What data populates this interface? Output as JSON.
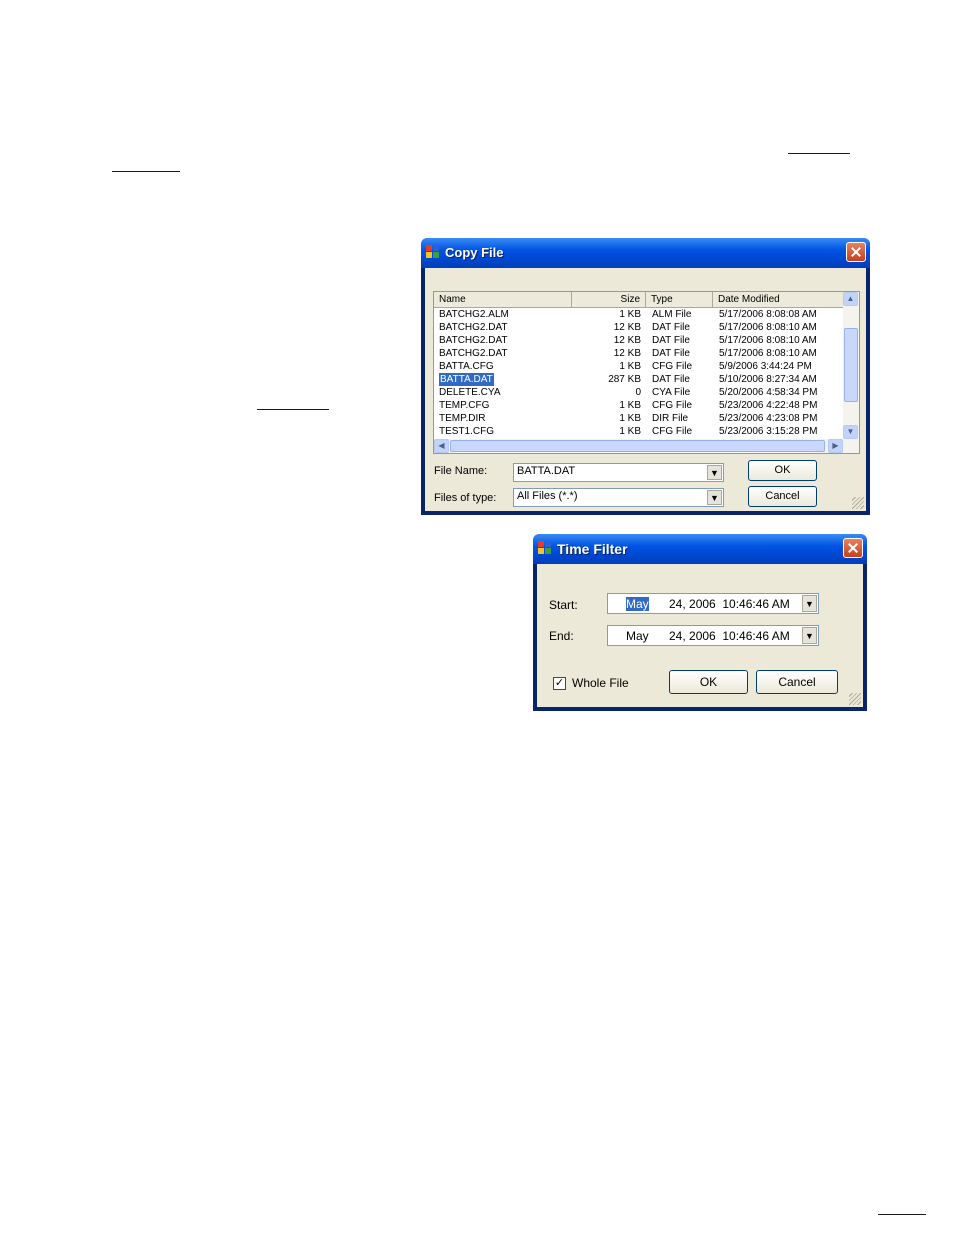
{
  "copy_file": {
    "title": "Copy File",
    "columns": [
      "Name",
      "Size",
      "Type",
      "Date Modified"
    ],
    "files": [
      {
        "name": "BATCHG2.ALM",
        "size": "1 KB",
        "type": "ALM File",
        "date": "5/17/2006 8:08:08 AM"
      },
      {
        "name": "BATCHG2.DAT",
        "size": "12 KB",
        "type": "DAT File",
        "date": "5/17/2006 8:08:10 AM"
      },
      {
        "name": "BATCHG2.DAT",
        "size": "12 KB",
        "type": "DAT File",
        "date": "5/17/2006 8:08:10 AM"
      },
      {
        "name": "BATCHG2.DAT",
        "size": "12 KB",
        "type": "DAT File",
        "date": "5/17/2006 8:08:10 AM"
      },
      {
        "name": "BATTA.CFG",
        "size": "1 KB",
        "type": "CFG File",
        "date": "5/9/2006 3:44:24 PM"
      },
      {
        "name": "BATTA.DAT",
        "size": "287 KB",
        "type": "DAT File",
        "date": "5/10/2006 8:27:34 AM"
      },
      {
        "name": "DELETE.CYA",
        "size": "0",
        "type": "CYA File",
        "date": "5/20/2006 4:58:34 PM"
      },
      {
        "name": "TEMP.CFG",
        "size": "1 KB",
        "type": "CFG File",
        "date": "5/23/2006 4:22:48 PM"
      },
      {
        "name": "TEMP.DIR",
        "size": "1 KB",
        "type": "DIR File",
        "date": "5/23/2006 4:23:08 PM"
      },
      {
        "name": "TEST1.CFG",
        "size": "1 KB",
        "type": "CFG File",
        "date": "5/23/2006 3:15:28 PM"
      }
    ],
    "file_name_label": "File Name:",
    "file_name_value": "BATTA.DAT",
    "files_of_type_label": "Files of type:",
    "files_of_type_value": "All Files (*.*)",
    "ok_label": "OK",
    "cancel_label": "Cancel"
  },
  "time_filter": {
    "title": "Time Filter",
    "start_label": "Start:",
    "start_month": "May",
    "start_rest": "24, 2006  10:46:46 AM",
    "end_label": "End:",
    "end_month": "May",
    "end_rest": "24, 2006  10:46:46 AM",
    "whole_file_label": "Whole File",
    "whole_file_checked": true,
    "ok_label": "OK",
    "cancel_label": "Cancel"
  }
}
